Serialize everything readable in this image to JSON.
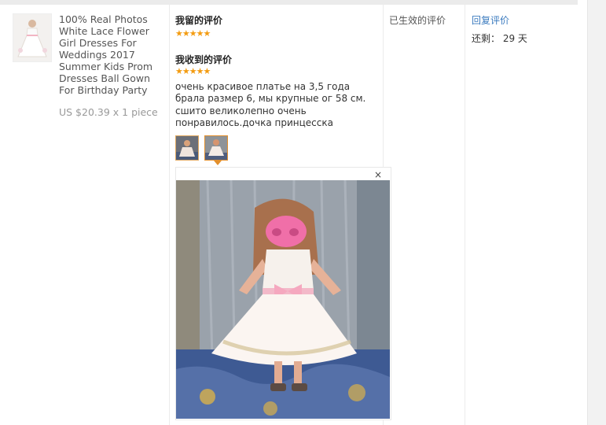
{
  "product": {
    "title": "100% Real Photos White Lace Flower Girl Dresses For Weddings 2017 Summer Kids Prom Dresses Ball Gown For Birthday Party",
    "price": "US $20.39 x 1 piece"
  },
  "my_review": {
    "title": "我留的评价",
    "stars": "★★★★★"
  },
  "received_review": {
    "title": "我收到的评价",
    "stars": "★★★★★",
    "text": "очень красивое платье на 3,5 года брала размер 6, мы крупные ог 58 см. сшито великолепно очень понравилось.дочка принцесска"
  },
  "viewer": {
    "close_label": "×"
  },
  "status": {
    "label": "已生效的评价"
  },
  "actions": {
    "reply_label": "回复评价",
    "remaining_label": "还剩： 29 天"
  },
  "colors": {
    "star": "#f39c12",
    "link": "#3b7bbf",
    "thumb_border_active": "#e28f2c"
  }
}
